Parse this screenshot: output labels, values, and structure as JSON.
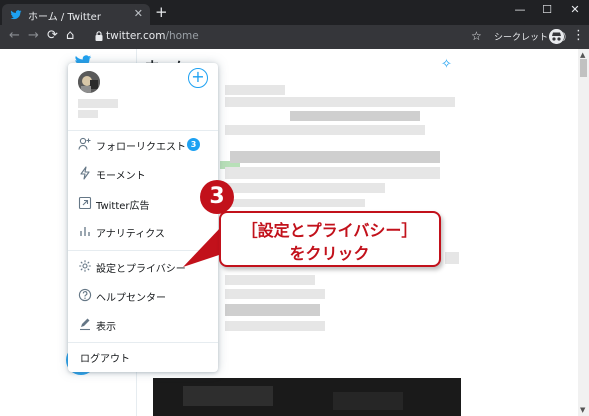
{
  "browser": {
    "tab_title": "ホーム / Twitter",
    "tab_close": "✕",
    "new_tab": "+",
    "window": {
      "minimize": "—",
      "maximize": "☐",
      "close": "✕"
    },
    "nav": {
      "back": "←",
      "forward": "→",
      "reload": "⟳",
      "home": "⌂"
    },
    "url_host": "twitter.com",
    "url_path": "/home",
    "bookmark_icon": "☆",
    "incognito_label": "シークレット（2）",
    "menu_icon": "⋮"
  },
  "feed": {
    "title": "ホーム",
    "sparkle_icon": "✧"
  },
  "account_menu": {
    "add_account": "+",
    "items": [
      {
        "label": "フォローリクエスト",
        "badge": "3",
        "icon": "person-plus-icon"
      },
      {
        "label": "モーメント",
        "icon": "lightning-icon"
      },
      {
        "label": "Twitter広告",
        "icon": "external-link-icon"
      },
      {
        "label": "アナリティクス",
        "icon": "bar-chart-icon"
      },
      {
        "label": "設定とプライバシー",
        "icon": "gear-icon"
      },
      {
        "label": "ヘルプセンター",
        "icon": "help-circle-icon"
      },
      {
        "label": "表示",
        "icon": "edit-icon"
      },
      {
        "label": "ログアウト"
      }
    ]
  },
  "annotation": {
    "step_number": "3",
    "line1": "［設定とプライバシー］",
    "line2": "をクリック",
    "color": "#c2111b"
  },
  "colors": {
    "accent": "#1da1f2",
    "chrome_dark": "#202124",
    "chrome_toolbar": "#35363a"
  }
}
